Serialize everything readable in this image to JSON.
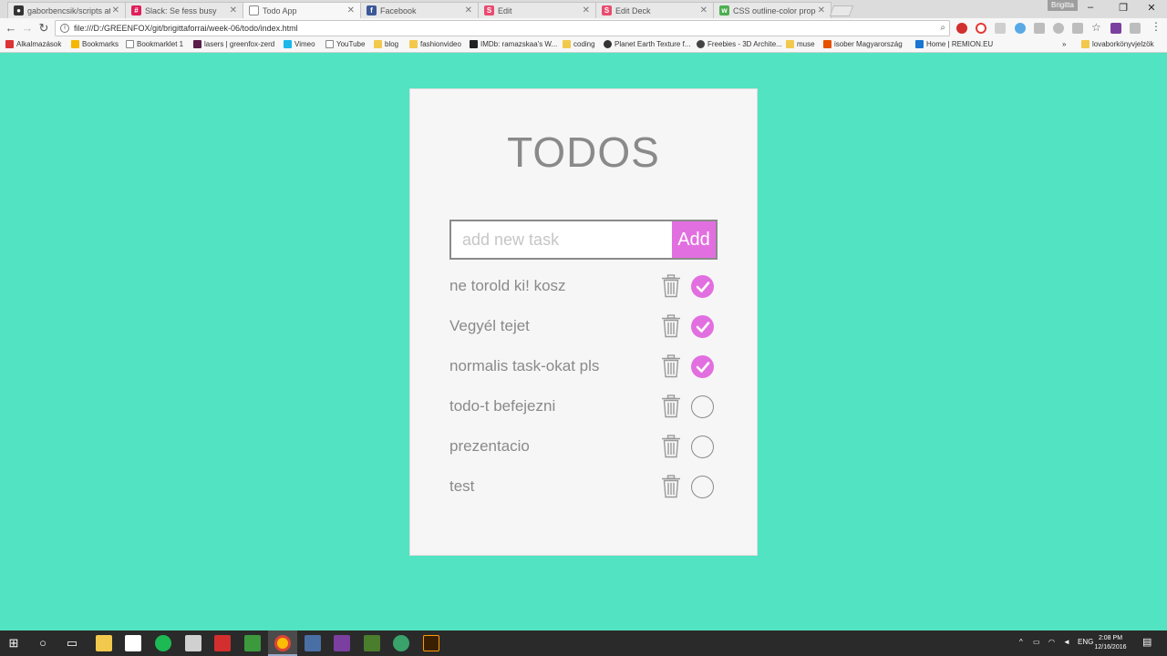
{
  "browser": {
    "tabs": [
      {
        "label": "gaborbencsik/scripts at",
        "icon": "github-icon",
        "color": "#333333"
      },
      {
        "label": "Slack: Se fess busy",
        "icon": "slack-icon",
        "color": "#e01e5a"
      },
      {
        "label": "Todo App",
        "icon": "document-icon",
        "color": "#777777",
        "active": true
      },
      {
        "label": "Facebook",
        "icon": "facebook-icon",
        "color": "#3b5998"
      },
      {
        "label": "Edit",
        "icon": "s-icon",
        "color": "#e94b6f"
      },
      {
        "label": "Edit Deck",
        "icon": "s-icon",
        "color": "#e94b6f"
      },
      {
        "label": "CSS outline-color prope",
        "icon": "w3-icon",
        "color": "#4caf50"
      }
    ],
    "user_badge": "Brigitta",
    "address": "file:///D:/GREENFOX/git/brigittaforrai/week-06/todo/index.html",
    "bookmarks": [
      "Alkalmazások",
      "Bookmarks",
      "Bookmarklet 1",
      "lasers | greenfox-zerd",
      "Vimeo",
      "YouTube",
      "blog",
      "fashionvideo",
      "IMDb: ramazskaa's W...",
      "coding",
      "Planet Earth Texture f...",
      "Freebies - 3D Archite...",
      "muse",
      "isober Magyarország",
      "Home | REMION.EU",
      "lovaborkönyvjelzök"
    ],
    "more_bookmarks": "»"
  },
  "app": {
    "title": "TODOS",
    "input_placeholder": "add new task",
    "add_label": "Add",
    "accent_color": "#e26fe0",
    "background_color": "#52e3c2",
    "tasks": [
      {
        "text": "ne torold ki! kosz",
        "done": true
      },
      {
        "text": "Vegyél tejet",
        "done": true
      },
      {
        "text": "normalis task-okat pls",
        "done": true
      },
      {
        "text": "todo-t befejezni",
        "done": false
      },
      {
        "text": "prezentacio",
        "done": false
      },
      {
        "text": "test",
        "done": false
      }
    ]
  },
  "taskbar": {
    "language": "ENG",
    "time": "2:08 PM",
    "date": "12/16/2016"
  }
}
